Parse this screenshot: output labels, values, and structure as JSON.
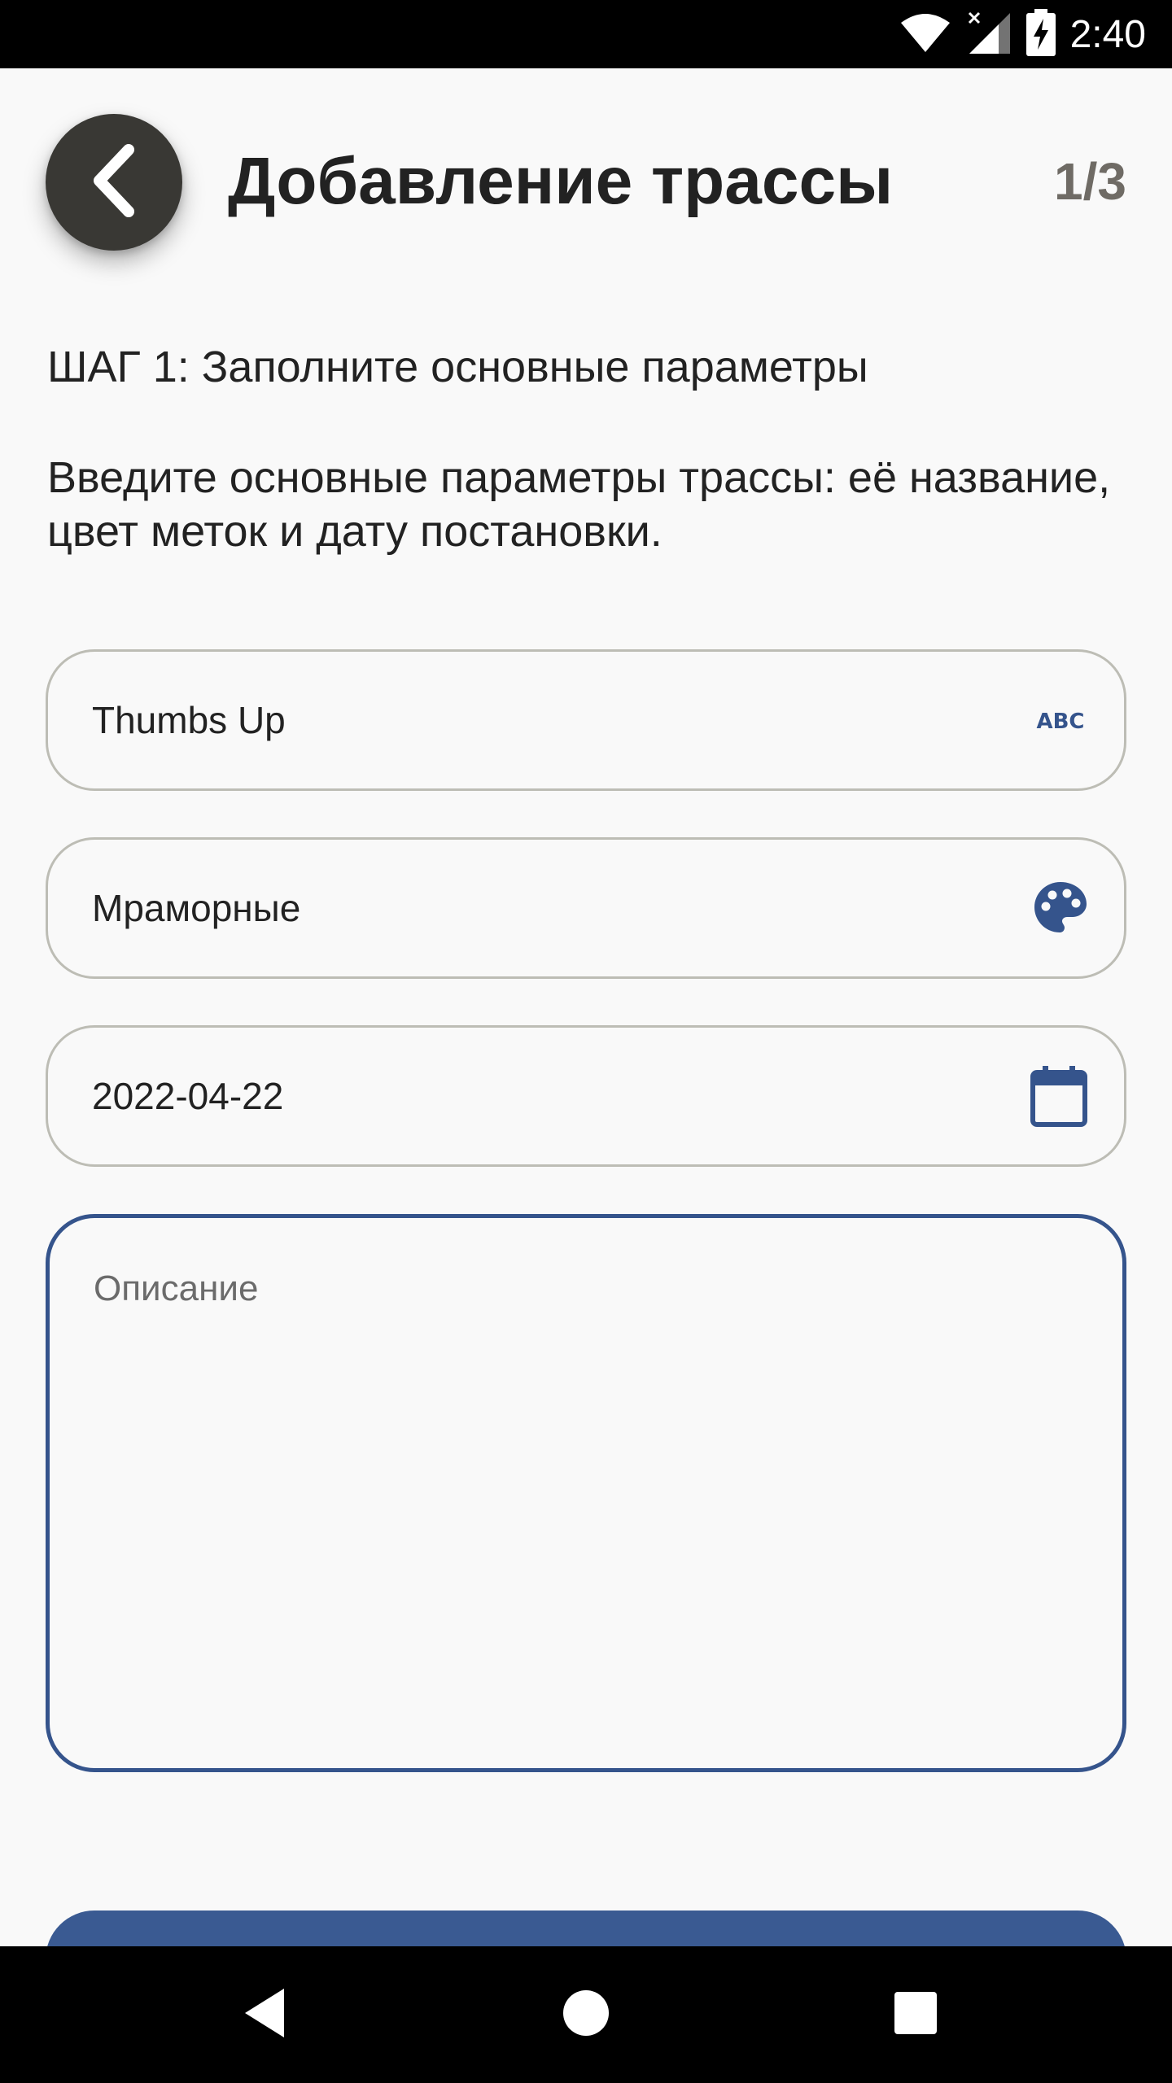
{
  "status_bar": {
    "time": "2:40",
    "icons": [
      "wifi-icon",
      "signal-icon",
      "battery-charging-icon"
    ]
  },
  "header": {
    "back_icon": "chevron-left-icon",
    "title": "Добавление трассы",
    "step_counter": "1/3"
  },
  "step": {
    "title": "ШАГ 1: Заполните основные параметры",
    "description": "Введите основные параметры трассы: её название, цвет меток и дату постановки."
  },
  "form": {
    "name_field": {
      "value": "Thumbs Up",
      "icon": "abc-icon"
    },
    "color_field": {
      "value": "Мраморные",
      "icon": "palette-icon"
    },
    "date_field": {
      "value": "2022-04-22",
      "icon": "calendar-icon"
    },
    "description_field": {
      "placeholder": "Описание",
      "value": ""
    }
  },
  "colors": {
    "accent": "#35548c",
    "back_button": "#393834",
    "field_border": "#bdbdb5",
    "background": "#f9f9f9"
  },
  "nav_bar": {
    "icons": [
      "back-triangle-icon",
      "home-circle-icon",
      "recents-square-icon"
    ]
  }
}
